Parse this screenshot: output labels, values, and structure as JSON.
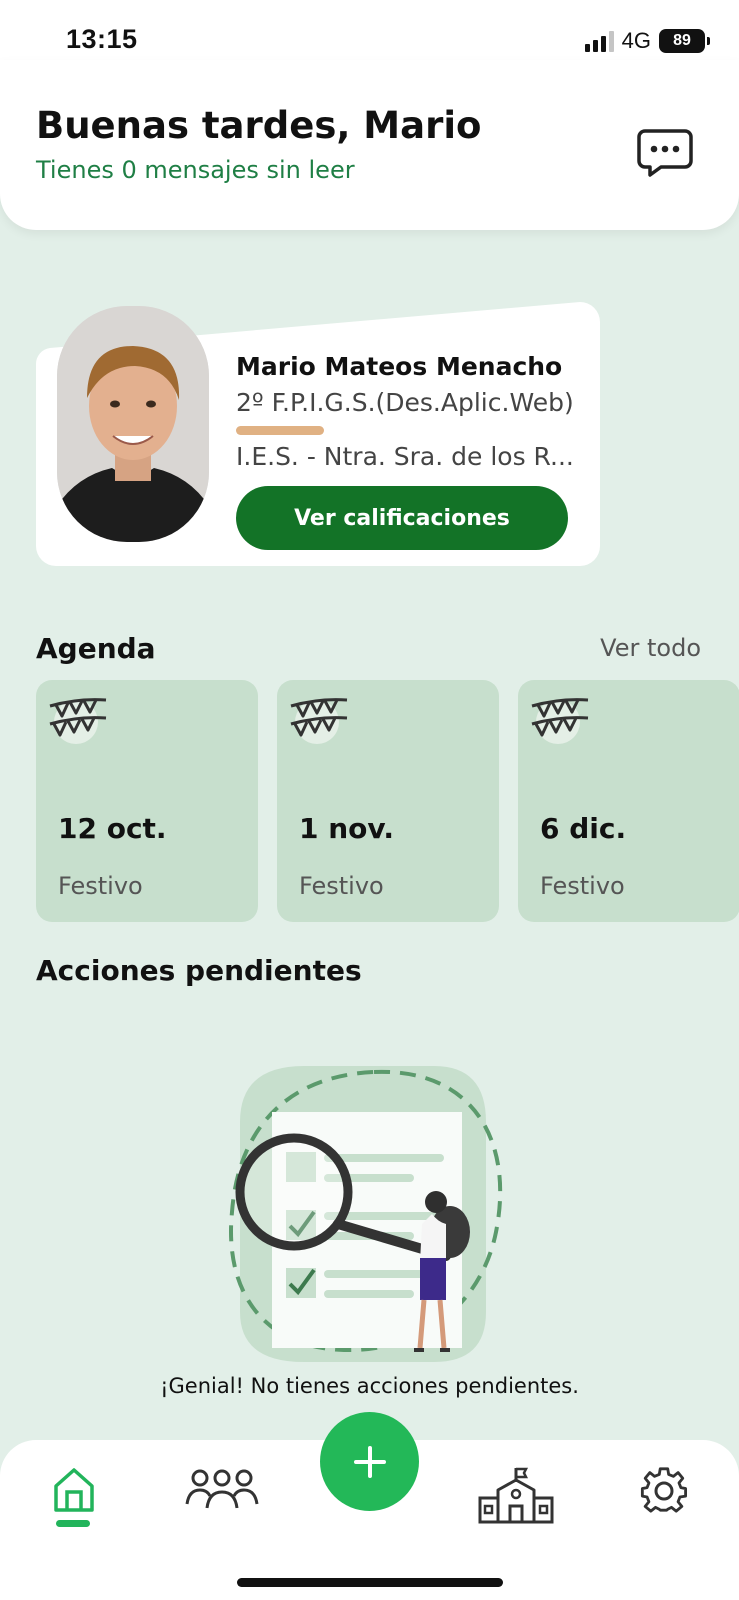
{
  "status_bar": {
    "time": "13:15",
    "network": "4G",
    "battery": "89"
  },
  "header": {
    "greeting": "Buenas tardes, Mario",
    "unread_messages": "Tienes 0 mensajes sin leer",
    "messages_icon": "chat-bubble-icon"
  },
  "profile": {
    "name": "Mario Mateos Menacho",
    "course": "2º F.P.I.G.S.(Des.Aplic.Web)",
    "school": "I.E.S. - Ntra. Sra. de los R...",
    "grades_button": "Ver calificaciones"
  },
  "agenda": {
    "title": "Agenda",
    "view_all": "Ver todo",
    "items": [
      {
        "date": "12 oct.",
        "type": "Festivo",
        "icon": "bunting-icon"
      },
      {
        "date": "1 nov.",
        "type": "Festivo",
        "icon": "bunting-icon"
      },
      {
        "date": "6 dic.",
        "type": "Festivo",
        "icon": "bunting-icon"
      }
    ]
  },
  "pending": {
    "title": "Acciones pendientes",
    "message": "¡Genial! No tienes acciones pendientes."
  },
  "nav": {
    "items": [
      {
        "name": "home",
        "icon": "home-icon",
        "active": true
      },
      {
        "name": "people",
        "icon": "group-icon",
        "active": false
      },
      {
        "name": "add",
        "icon": "plus-icon",
        "active": false
      },
      {
        "name": "school",
        "icon": "school-building-icon",
        "active": false
      },
      {
        "name": "settings",
        "icon": "gear-icon",
        "active": false
      }
    ]
  },
  "colors": {
    "primary_green": "#137327",
    "accent_green": "#23b858",
    "background": "#e2efe8",
    "card_green": "#c7dfcd",
    "greeting_subtitle": "#1f7f45"
  }
}
